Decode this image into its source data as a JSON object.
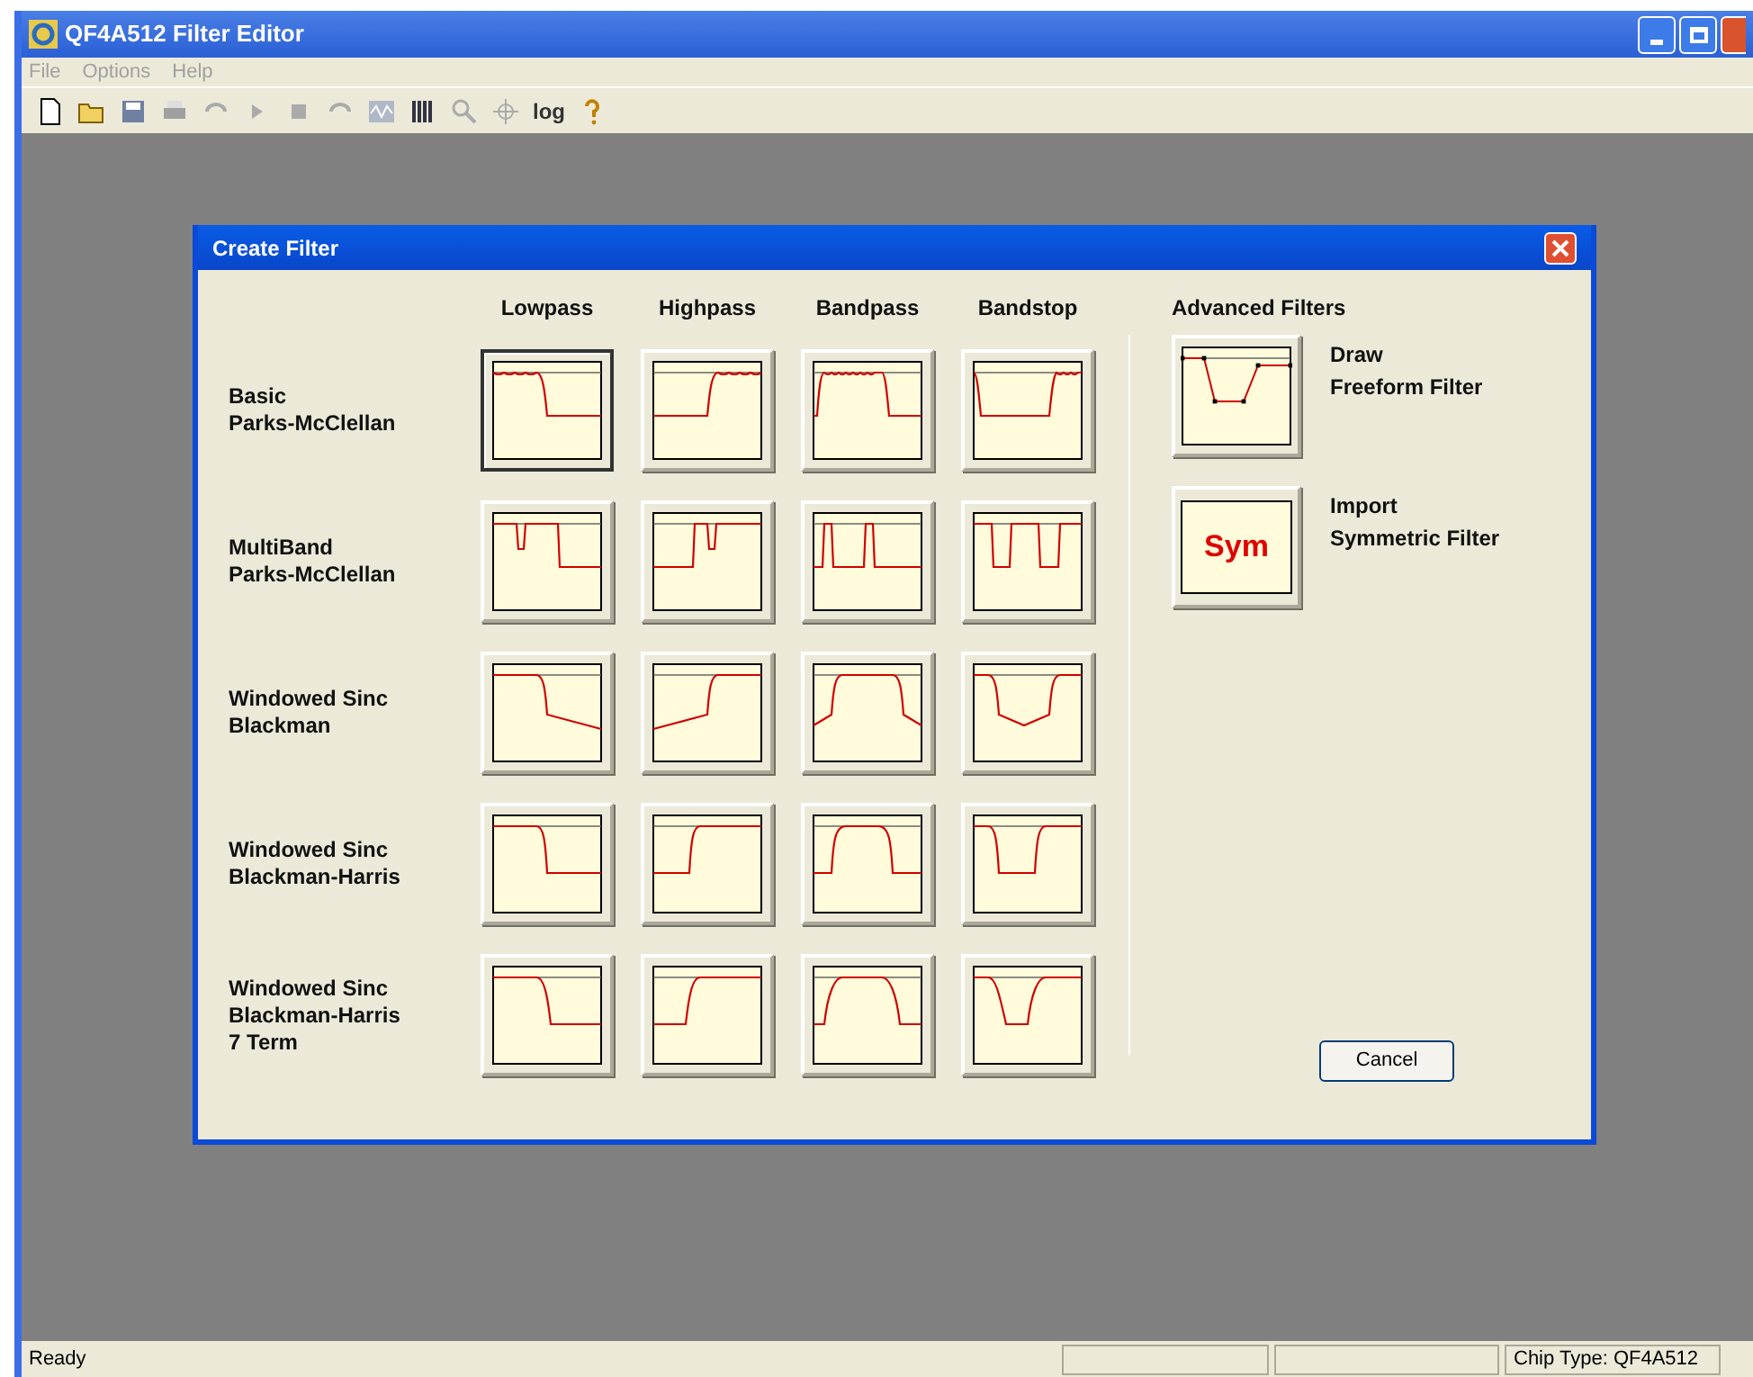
{
  "window": {
    "title": "QF4A512 Filter Editor"
  },
  "menu": [
    "File",
    "Options",
    "Help"
  ],
  "toolbar": {
    "log_label": "log"
  },
  "dialog": {
    "title": "Create Filter",
    "columns": [
      {
        "label": "Lowpass",
        "kind": "lowpass"
      },
      {
        "label": "Highpass",
        "kind": "highpass"
      },
      {
        "label": "Bandpass",
        "kind": "bandpass"
      },
      {
        "label": "Bandstop",
        "kind": "bandstop"
      }
    ],
    "rows": [
      {
        "label": [
          "Basic",
          "Parks-McClellan"
        ],
        "kind": "ripple",
        "selected": [
          true,
          false,
          false,
          false
        ]
      },
      {
        "label": [
          "MultiBand",
          "Parks-McClellan"
        ],
        "kind": "multiband",
        "selected": [
          false,
          false,
          false,
          false
        ]
      },
      {
        "label": [
          "Windowed Sinc",
          "Blackman"
        ],
        "kind": "blackman",
        "selected": [
          false,
          false,
          false,
          false
        ]
      },
      {
        "label": [
          "Windowed Sinc",
          "Blackman-Harris"
        ],
        "kind": "harris",
        "selected": [
          false,
          false,
          false,
          false
        ]
      },
      {
        "label": [
          "Windowed Sinc",
          "Blackman-Harris",
          "7 Term"
        ],
        "kind": "harris7",
        "selected": [
          false,
          false,
          false,
          false
        ]
      }
    ],
    "advanced": {
      "title": "Advanced Filters",
      "items": [
        {
          "kind": "freeform",
          "label": [
            "Draw",
            "Freeform Filter"
          ]
        },
        {
          "kind": "symmetric",
          "icon_text": "Sym",
          "label": [
            "Import",
            "Symmetric Filter"
          ]
        }
      ]
    },
    "cancel": "Cancel"
  },
  "status_bar": {
    "message": "Ready",
    "chip": "Chip Type: QF4A512"
  }
}
